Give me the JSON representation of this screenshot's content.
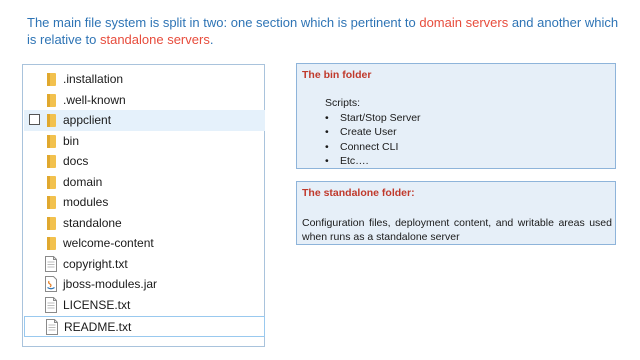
{
  "intro": {
    "part1": "The main file system is split in two: one section which is pertinent to ",
    "highlight1": "domain servers",
    "part2": " and another which is relative to ",
    "highlight2": "standalone servers",
    "part3": "."
  },
  "colors": {
    "intro_text": "#2e74b5",
    "highlight": "#e74c3c",
    "box_title": "#c0392b",
    "box_fill": "#e6eff8",
    "box_border": "#8eb4da",
    "folder": "#f2c14e",
    "selection": "#e5f1fb"
  },
  "files": [
    {
      "name": ".installation",
      "icon": "folder-icon"
    },
    {
      "name": ".well-known",
      "icon": "folder-icon"
    },
    {
      "name": "appclient",
      "icon": "folder-icon",
      "selected": true,
      "checkbox": true
    },
    {
      "name": "bin",
      "icon": "folder-icon"
    },
    {
      "name": "docs",
      "icon": "folder-icon"
    },
    {
      "name": "domain",
      "icon": "folder-icon"
    },
    {
      "name": "modules",
      "icon": "folder-icon"
    },
    {
      "name": "standalone",
      "icon": "folder-icon"
    },
    {
      "name": "welcome-content",
      "icon": "folder-icon"
    },
    {
      "name": "copyright.txt",
      "icon": "text-file-icon"
    },
    {
      "name": "jboss-modules.jar",
      "icon": "jar-file-icon"
    },
    {
      "name": "LICENSE.txt",
      "icon": "text-file-icon"
    },
    {
      "name": "README.txt",
      "icon": "text-file-icon",
      "focused": true
    }
  ],
  "bin_box": {
    "title": "The bin folder",
    "subtitle": "Scripts:",
    "bullets": [
      "Start/Stop Server",
      "Create User",
      "Connect CLI",
      "Etc…."
    ]
  },
  "standalone_box": {
    "title": "The standalone folder:",
    "description": "Configuration files, deployment content, and writable areas used when runs as a standalone server"
  }
}
